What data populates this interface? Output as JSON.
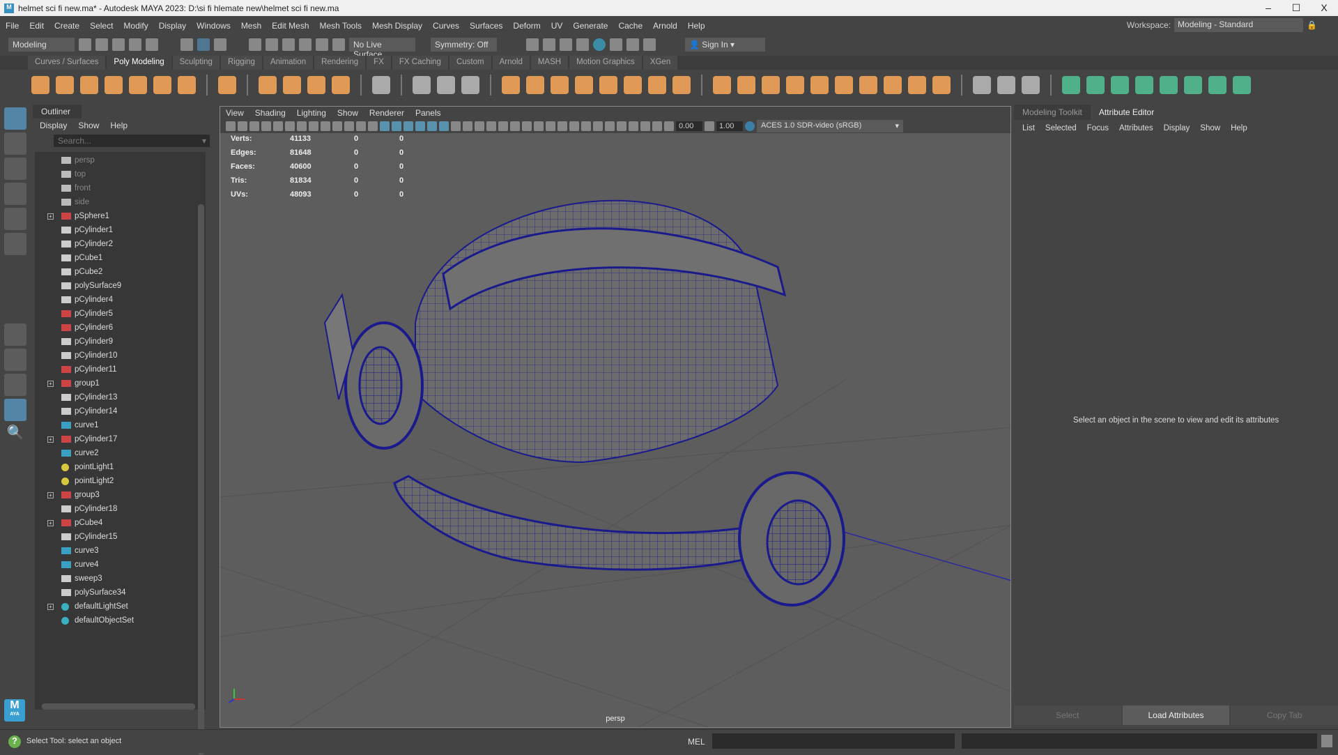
{
  "title": "helmet sci fi new.ma* - Autodesk MAYA 2023: D:\\si fi hlemate new\\helmet sci fi new.ma",
  "window_controls": {
    "minimize": "–",
    "maximize": "☐",
    "close": "X"
  },
  "menu": [
    "File",
    "Edit",
    "Create",
    "Select",
    "Modify",
    "Display",
    "Windows",
    "Mesh",
    "Edit Mesh",
    "Mesh Tools",
    "Mesh Display",
    "Curves",
    "Surfaces",
    "Deform",
    "UV",
    "Generate",
    "Cache",
    "Arnold",
    "Help"
  ],
  "workspace": {
    "label": "Workspace:",
    "value": "Modeling - Standard"
  },
  "statusline": {
    "mode": "Modeling",
    "live_surface": "No Live Surface",
    "symmetry": "Symmetry: Off",
    "sign_in": "Sign In"
  },
  "shelf_tabs": [
    "Curves / Surfaces",
    "Poly Modeling",
    "Sculpting",
    "Rigging",
    "Animation",
    "Rendering",
    "FX",
    "FX Caching",
    "Custom",
    "Arnold",
    "MASH",
    "Motion Graphics",
    "XGen"
  ],
  "shelf_active": "Poly Modeling",
  "outliner": {
    "title": "Outliner",
    "menu": [
      "Display",
      "Show",
      "Help"
    ],
    "search_placeholder": "Search...",
    "items": [
      {
        "name": "persp",
        "type": "camera"
      },
      {
        "name": "top",
        "type": "camera"
      },
      {
        "name": "front",
        "type": "camera"
      },
      {
        "name": "side",
        "type": "camera"
      },
      {
        "name": "pSphere1",
        "type": "group",
        "expand": true
      },
      {
        "name": "pCylinder1",
        "type": "mesh"
      },
      {
        "name": "pCylinder2",
        "type": "mesh"
      },
      {
        "name": "pCube1",
        "type": "mesh"
      },
      {
        "name": "pCube2",
        "type": "mesh"
      },
      {
        "name": "polySurface9",
        "type": "mesh"
      },
      {
        "name": "pCylinder4",
        "type": "mesh"
      },
      {
        "name": "pCylinder5",
        "type": "group"
      },
      {
        "name": "pCylinder6",
        "type": "group"
      },
      {
        "name": "pCylinder9",
        "type": "mesh"
      },
      {
        "name": "pCylinder10",
        "type": "mesh"
      },
      {
        "name": "pCylinder11",
        "type": "group"
      },
      {
        "name": "group1",
        "type": "group",
        "expand": true
      },
      {
        "name": "pCylinder13",
        "type": "mesh"
      },
      {
        "name": "pCylinder14",
        "type": "mesh"
      },
      {
        "name": "curve1",
        "type": "curve"
      },
      {
        "name": "pCylinder17",
        "type": "group",
        "expand": true
      },
      {
        "name": "curve2",
        "type": "curve"
      },
      {
        "name": "pointLight1",
        "type": "light"
      },
      {
        "name": "pointLight2",
        "type": "light"
      },
      {
        "name": "group3",
        "type": "group",
        "expand": true
      },
      {
        "name": "pCylinder18",
        "type": "mesh"
      },
      {
        "name": "pCube4",
        "type": "group",
        "expand": true
      },
      {
        "name": "pCylinder15",
        "type": "mesh"
      },
      {
        "name": "curve3",
        "type": "curve"
      },
      {
        "name": "curve4",
        "type": "curve"
      },
      {
        "name": "sweep3",
        "type": "mesh"
      },
      {
        "name": "polySurface34",
        "type": "mesh"
      },
      {
        "name": "defaultLightSet",
        "type": "set",
        "expand": true
      },
      {
        "name": "defaultObjectSet",
        "type": "set"
      }
    ]
  },
  "viewport": {
    "menu": [
      "View",
      "Shading",
      "Lighting",
      "Show",
      "Renderer",
      "Panels"
    ],
    "exposure": "0.00",
    "gamma": "1.00",
    "color_space": "ACES 1.0 SDR-video (sRGB)",
    "camera": "persp",
    "stats": [
      {
        "label": "Verts:",
        "v": [
          "41133",
          "0",
          "0"
        ]
      },
      {
        "label": "Edges:",
        "v": [
          "81648",
          "0",
          "0"
        ]
      },
      {
        "label": "Faces:",
        "v": [
          "40600",
          "0",
          "0"
        ]
      },
      {
        "label": "Tris:",
        "v": [
          "81834",
          "0",
          "0"
        ]
      },
      {
        "label": "UVs:",
        "v": [
          "48093",
          "0",
          "0"
        ]
      }
    ]
  },
  "right_panel": {
    "tabs": [
      "Modeling Toolkit",
      "Attribute Editor"
    ],
    "active": "Attribute Editor",
    "menu": [
      "List",
      "Selected",
      "Focus",
      "Attributes",
      "Display",
      "Show",
      "Help"
    ],
    "message": "Select an object in the scene to view and edit its attributes",
    "buttons": [
      "Select",
      "Load Attributes",
      "Copy Tab"
    ]
  },
  "statusbar": {
    "help": "?",
    "message": "Select Tool: select an object",
    "mel": "MEL"
  },
  "logo": {
    "letter": "M",
    "text": "AYA"
  },
  "colors": {
    "wire": "#1a1a8c",
    "accent": "#5285a6",
    "shelf_orange": "#e09a55",
    "shelf_green": "#4fb08a"
  }
}
